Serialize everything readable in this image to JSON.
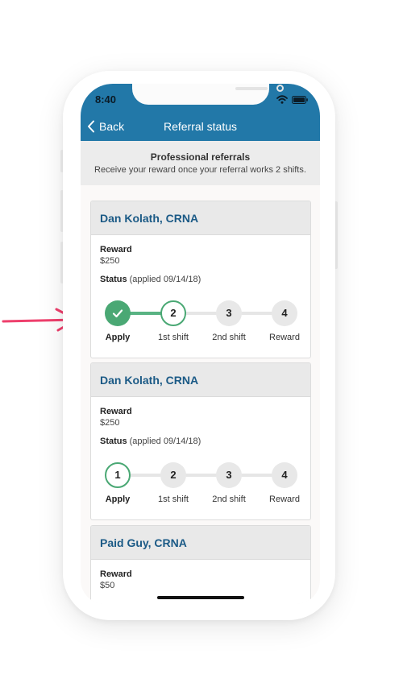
{
  "status_bar": {
    "time": "8:40"
  },
  "nav": {
    "back_label": "Back",
    "title": "Referral status"
  },
  "banner": {
    "title": "Professional referrals",
    "subtitle": "Receive your reward once your referral works 2 shifts."
  },
  "steps": [
    {
      "number": "1",
      "label": "Apply"
    },
    {
      "number": "2",
      "label": "1st shift"
    },
    {
      "number": "3",
      "label": "2nd shift"
    },
    {
      "number": "4",
      "label": "Reward"
    }
  ],
  "referrals": [
    {
      "name": "Dan Kolath, CRNA",
      "reward_label": "Reward",
      "reward_value": "$250",
      "status_label": "Status",
      "status_detail": "(applied 09/14/18)",
      "completed_steps": 1,
      "current_step": 2
    },
    {
      "name": "Dan Kolath, CRNA",
      "reward_label": "Reward",
      "reward_value": "$250",
      "status_label": "Status",
      "status_detail": "(applied 09/14/18)",
      "completed_steps": 0,
      "current_step": 1
    },
    {
      "name": "Paid Guy, CRNA",
      "reward_label": "Reward",
      "reward_value": "$50"
    }
  ],
  "colors": {
    "header": "#2278a8",
    "accent_green": "#4aa874",
    "name_blue": "#1b5a86",
    "annotation_arrow": "#ee3f6c"
  },
  "icons": [
    "arrow-right-icon",
    "back-chevron-icon",
    "wifi-icon",
    "battery-icon",
    "checkmark-icon"
  ]
}
